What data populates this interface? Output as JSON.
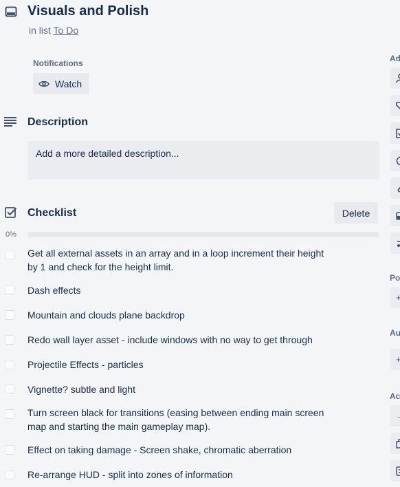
{
  "card": {
    "title": "Visuals and Polish",
    "in_list_prefix": "in list",
    "list_name": "To Do"
  },
  "notifications": {
    "label": "Notifications",
    "watch_label": "Watch"
  },
  "description": {
    "title": "Description",
    "placeholder": "Add a more detailed description..."
  },
  "checklist": {
    "title": "Checklist",
    "delete_label": "Delete",
    "progress_text": "0%",
    "progress": 0,
    "items": [
      {
        "text": "Get all external assets in an array and in a loop increment their height by 1 and check for the height limit.",
        "checked": false
      },
      {
        "text": "Dash effects",
        "checked": false
      },
      {
        "text": "Mountain and clouds plane backdrop",
        "checked": false
      },
      {
        "text": "Redo wall layer asset - include windows with no way to get through",
        "checked": false
      },
      {
        "text": "Projectile Effects - particles",
        "checked": false
      },
      {
        "text": "Vignette? subtle and light",
        "checked": false
      },
      {
        "text": "Turn screen black for transitions (easing between ending main screen map and starting the main gameplay map).",
        "checked": false
      },
      {
        "text": "Effect on taking damage - Screen shake, chromatic aberration",
        "checked": false
      },
      {
        "text": "Re-arrange HUD - split into zones of information",
        "checked": false
      }
    ]
  },
  "sidebar": {
    "add_label": "Ad",
    "powerups_label": "Po",
    "automation_label": "Au",
    "actions_label": "Ac",
    "add_buttons": [
      {
        "icon": "person-icon"
      },
      {
        "icon": "tag-icon"
      },
      {
        "icon": "checklist-icon"
      },
      {
        "icon": "clock-icon"
      },
      {
        "icon": "paperclip-icon"
      },
      {
        "icon": "cover-icon"
      },
      {
        "icon": "custom-field-icon"
      }
    ],
    "powerup_button_text": "+",
    "automation_button_text": "+",
    "action_buttons": [
      {
        "icon": "arrow-icon",
        "text": "→"
      },
      {
        "icon": "copy-icon"
      },
      {
        "icon": "template-icon"
      }
    ]
  }
}
